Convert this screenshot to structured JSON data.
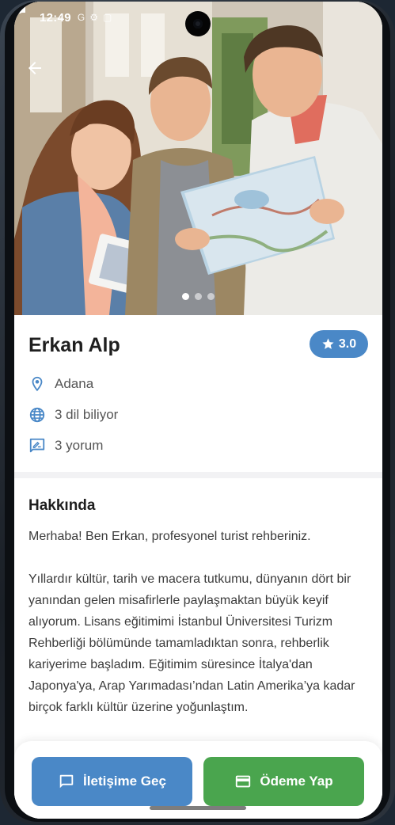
{
  "status_bar": {
    "time": "12:49",
    "icons_left": [
      "G",
      "⚙",
      "▢"
    ],
    "icons_right": [
      "signal-icon",
      "battery-icon"
    ]
  },
  "hero": {
    "back_icon": "arrow-left-icon",
    "carousel_total": 3,
    "carousel_active": 0
  },
  "profile": {
    "name": "Erkan Alp",
    "rating": "3.0",
    "rating_icon": "star-icon",
    "location": "Adana",
    "location_icon": "location-pin-icon",
    "languages": "3 dil biliyor",
    "languages_icon": "globe-icon",
    "reviews": "3 yorum",
    "reviews_icon": "rate-review-icon"
  },
  "about": {
    "title": "Hakkında",
    "text": "Merhaba! Ben Erkan, profesyonel turist rehberiniz.\n\nYıllardır kültür, tarih ve macera tutkumu, dünyanın dört bir yanından gelen misafirlerle paylaşmaktan büyük keyif alıyorum. Lisans eğitimimi İstanbul Üniversitesi Turizm Rehberliği bölümünde tamamladıktan sonra, rehberlik kariyerime başladım. Eğitimim süresince İtalya'dan Japonya'ya, Arap Yarımadası’ndan Latin Amerika’ya kadar birçok farklı kültür üzerine yoğunlaştım."
  },
  "actions": {
    "contact_label": "İletişime Geç",
    "contact_icon": "chat-icon",
    "pay_label": "Ödeme Yap",
    "pay_icon": "credit-card-icon"
  },
  "colors": {
    "primary": "#4a88c7",
    "success": "#4aa54e",
    "icon": "#4a88c7"
  }
}
